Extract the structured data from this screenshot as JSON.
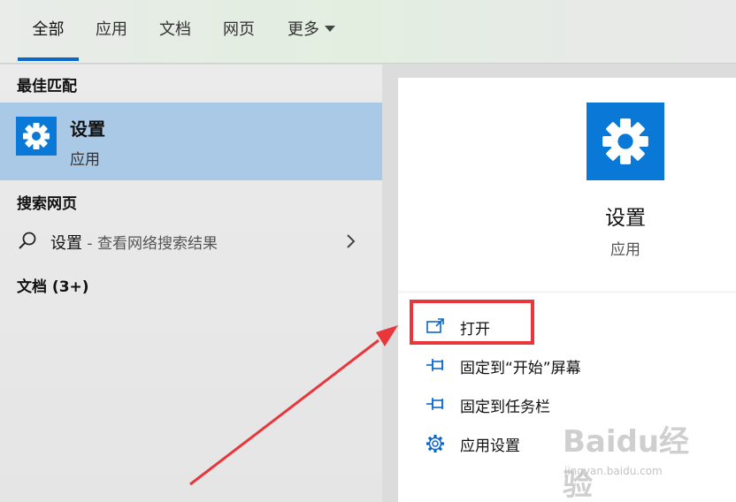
{
  "tabs": [
    {
      "label": "全部",
      "active": true
    },
    {
      "label": "应用"
    },
    {
      "label": "文档"
    },
    {
      "label": "网页"
    },
    {
      "label": "更多"
    }
  ],
  "left": {
    "best_match_title": "最佳匹配",
    "best_match": {
      "name": "设置",
      "type": "应用",
      "icon": "gear-icon"
    },
    "web_title": "搜索网页",
    "web_result": {
      "query": "设置",
      "suffix": " - 查看网络搜索结果"
    },
    "docs_title": "文档 (3+)"
  },
  "right": {
    "app_name": "设置",
    "app_type": "应用",
    "actions": [
      {
        "label": "打开",
        "icon": "open-window-icon"
      },
      {
        "label": "固定到“开始”屏幕",
        "icon": "pin-icon"
      },
      {
        "label": "固定到任务栏",
        "icon": "pin-icon"
      },
      {
        "label": "应用设置",
        "icon": "gear-outline-icon"
      }
    ]
  },
  "watermark": {
    "brand": "Baidu经验",
    "url": "jingyan.baidu.com"
  },
  "colors": {
    "accent": "#0a78d6",
    "selection": "#a9c9e7",
    "annotation": "#e8363a"
  }
}
